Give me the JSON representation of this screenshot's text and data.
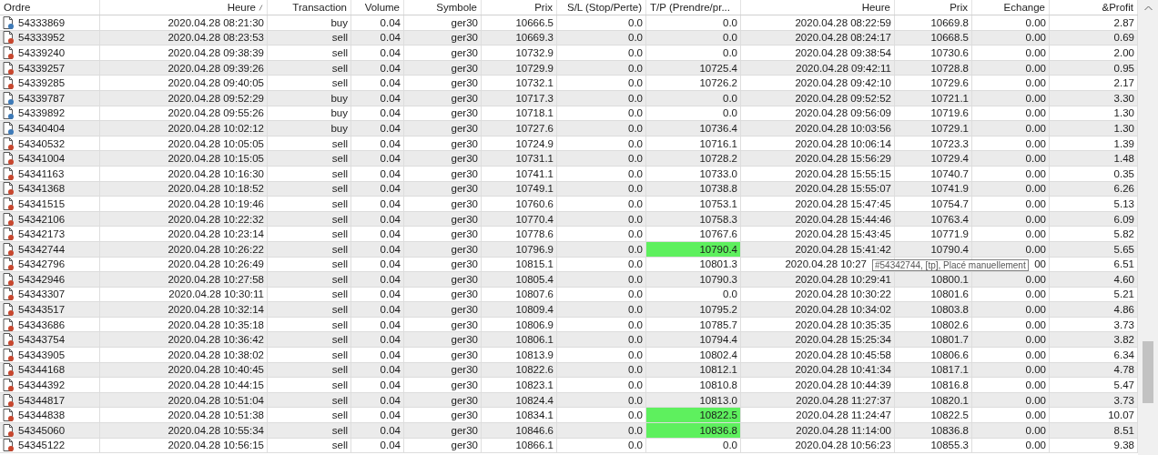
{
  "table": {
    "columns": [
      {
        "label": "Ordre",
        "sorted": false
      },
      {
        "label": "Heure",
        "sorted": true
      },
      {
        "label": "Transaction",
        "sorted": false
      },
      {
        "label": "Volume",
        "sorted": false
      },
      {
        "label": "Symbole",
        "sorted": false
      },
      {
        "label": "Prix",
        "sorted": false
      },
      {
        "label": "S/L (Stop/Perte)",
        "sorted": false
      },
      {
        "label": "T/P (Prendre/pr...",
        "sorted": false
      },
      {
        "label": "Heure",
        "sorted": false
      },
      {
        "label": "Prix",
        "sorted": false
      },
      {
        "label": "Echange",
        "sorted": false
      },
      {
        "label": "&Profit",
        "sorted": false
      }
    ],
    "rows": [
      {
        "kind": "buy",
        "order": "54333869",
        "open_time": "2020.04.28 08:21:30",
        "type": "buy",
        "volume": "0.04",
        "symbol": "ger30",
        "open_price": "10666.5",
        "sl": "0.0",
        "tp": "0.0",
        "tp_highlighted": false,
        "close_time": "2020.04.28 08:22:59",
        "close_price": "10669.8",
        "swap": "0.00",
        "profit": "2.87"
      },
      {
        "kind": "sell",
        "order": "54333952",
        "open_time": "2020.04.28 08:23:53",
        "type": "sell",
        "volume": "0.04",
        "symbol": "ger30",
        "open_price": "10669.3",
        "sl": "0.0",
        "tp": "0.0",
        "tp_highlighted": false,
        "close_time": "2020.04.28 08:24:17",
        "close_price": "10668.5",
        "swap": "0.00",
        "profit": "0.69"
      },
      {
        "kind": "sell",
        "order": "54339240",
        "open_time": "2020.04.28 09:38:39",
        "type": "sell",
        "volume": "0.04",
        "symbol": "ger30",
        "open_price": "10732.9",
        "sl": "0.0",
        "tp": "0.0",
        "tp_highlighted": false,
        "close_time": "2020.04.28 09:38:54",
        "close_price": "10730.6",
        "swap": "0.00",
        "profit": "2.00"
      },
      {
        "kind": "sell",
        "order": "54339257",
        "open_time": "2020.04.28 09:39:26",
        "type": "sell",
        "volume": "0.04",
        "symbol": "ger30",
        "open_price": "10729.9",
        "sl": "0.0",
        "tp": "10725.4",
        "tp_highlighted": false,
        "close_time": "2020.04.28 09:42:11",
        "close_price": "10728.8",
        "swap": "0.00",
        "profit": "0.95"
      },
      {
        "kind": "sell",
        "order": "54339285",
        "open_time": "2020.04.28 09:40:05",
        "type": "sell",
        "volume": "0.04",
        "symbol": "ger30",
        "open_price": "10732.1",
        "sl": "0.0",
        "tp": "10726.2",
        "tp_highlighted": false,
        "close_time": "2020.04.28 09:42:10",
        "close_price": "10729.6",
        "swap": "0.00",
        "profit": "2.17"
      },
      {
        "kind": "buy",
        "order": "54339787",
        "open_time": "2020.04.28 09:52:29",
        "type": "buy",
        "volume": "0.04",
        "symbol": "ger30",
        "open_price": "10717.3",
        "sl": "0.0",
        "tp": "0.0",
        "tp_highlighted": false,
        "close_time": "2020.04.28 09:52:52",
        "close_price": "10721.1",
        "swap": "0.00",
        "profit": "3.30"
      },
      {
        "kind": "buy",
        "order": "54339892",
        "open_time": "2020.04.28 09:55:26",
        "type": "buy",
        "volume": "0.04",
        "symbol": "ger30",
        "open_price": "10718.1",
        "sl": "0.0",
        "tp": "0.0",
        "tp_highlighted": false,
        "close_time": "2020.04.28 09:56:09",
        "close_price": "10719.6",
        "swap": "0.00",
        "profit": "1.30"
      },
      {
        "kind": "buy",
        "order": "54340404",
        "open_time": "2020.04.28 10:02:12",
        "type": "buy",
        "volume": "0.04",
        "symbol": "ger30",
        "open_price": "10727.6",
        "sl": "0.0",
        "tp": "10736.4",
        "tp_highlighted": false,
        "close_time": "2020.04.28 10:03:56",
        "close_price": "10729.1",
        "swap": "0.00",
        "profit": "1.30"
      },
      {
        "kind": "sell",
        "order": "54340532",
        "open_time": "2020.04.28 10:05:05",
        "type": "sell",
        "volume": "0.04",
        "symbol": "ger30",
        "open_price": "10724.9",
        "sl": "0.0",
        "tp": "10716.1",
        "tp_highlighted": false,
        "close_time": "2020.04.28 10:06:14",
        "close_price": "10723.3",
        "swap": "0.00",
        "profit": "1.39"
      },
      {
        "kind": "sell",
        "order": "54341004",
        "open_time": "2020.04.28 10:15:05",
        "type": "sell",
        "volume": "0.04",
        "symbol": "ger30",
        "open_price": "10731.1",
        "sl": "0.0",
        "tp": "10728.2",
        "tp_highlighted": false,
        "close_time": "2020.04.28 15:56:29",
        "close_price": "10729.4",
        "swap": "0.00",
        "profit": "1.48"
      },
      {
        "kind": "sell",
        "order": "54341163",
        "open_time": "2020.04.28 10:16:30",
        "type": "sell",
        "volume": "0.04",
        "symbol": "ger30",
        "open_price": "10741.1",
        "sl": "0.0",
        "tp": "10733.0",
        "tp_highlighted": false,
        "close_time": "2020.04.28 15:55:15",
        "close_price": "10740.7",
        "swap": "0.00",
        "profit": "0.35"
      },
      {
        "kind": "sell",
        "order": "54341368",
        "open_time": "2020.04.28 10:18:52",
        "type": "sell",
        "volume": "0.04",
        "symbol": "ger30",
        "open_price": "10749.1",
        "sl": "0.0",
        "tp": "10738.8",
        "tp_highlighted": false,
        "close_time": "2020.04.28 15:55:07",
        "close_price": "10741.9",
        "swap": "0.00",
        "profit": "6.26"
      },
      {
        "kind": "sell",
        "order": "54341515",
        "open_time": "2020.04.28 10:19:46",
        "type": "sell",
        "volume": "0.04",
        "symbol": "ger30",
        "open_price": "10760.6",
        "sl": "0.0",
        "tp": "10753.1",
        "tp_highlighted": false,
        "close_time": "2020.04.28 15:47:45",
        "close_price": "10754.7",
        "swap": "0.00",
        "profit": "5.13"
      },
      {
        "kind": "sell",
        "order": "54342106",
        "open_time": "2020.04.28 10:22:32",
        "type": "sell",
        "volume": "0.04",
        "symbol": "ger30",
        "open_price": "10770.4",
        "sl": "0.0",
        "tp": "10758.3",
        "tp_highlighted": false,
        "close_time": "2020.04.28 15:44:46",
        "close_price": "10763.4",
        "swap": "0.00",
        "profit": "6.09"
      },
      {
        "kind": "sell",
        "order": "54342173",
        "open_time": "2020.04.28 10:23:14",
        "type": "sell",
        "volume": "0.04",
        "symbol": "ger30",
        "open_price": "10778.6",
        "sl": "0.0",
        "tp": "10767.6",
        "tp_highlighted": false,
        "close_time": "2020.04.28 15:43:45",
        "close_price": "10771.9",
        "swap": "0.00",
        "profit": "5.82"
      },
      {
        "kind": "sell",
        "order": "54342744",
        "open_time": "2020.04.28 10:26:22",
        "type": "sell",
        "volume": "0.04",
        "symbol": "ger30",
        "open_price": "10796.9",
        "sl": "0.0",
        "tp": "10790.4",
        "tp_highlighted": true,
        "close_time": "2020.04.28 15:41:42",
        "close_price": "10790.4",
        "swap": "0.00",
        "profit": "5.65"
      },
      {
        "kind": "sell",
        "order": "54342796",
        "open_time": "2020.04.28 10:26:49",
        "type": "sell",
        "volume": "0.04",
        "symbol": "ger30",
        "open_price": "10815.1",
        "sl": "0.0",
        "tp": "10801.3",
        "tp_highlighted": false,
        "close_time": "2020.04.28 10:27",
        "swap": "00",
        "profit": "6.51",
        "tooltip": "#54342744, [tp], Placé manuellement"
      },
      {
        "kind": "sell",
        "order": "54342946",
        "open_time": "2020.04.28 10:27:58",
        "type": "sell",
        "volume": "0.04",
        "symbol": "ger30",
        "open_price": "10805.4",
        "sl": "0.0",
        "tp": "10790.3",
        "tp_highlighted": false,
        "close_time": "2020.04.28 10:29:41",
        "close_price": "10800.1",
        "swap": "0.00",
        "profit": "4.60"
      },
      {
        "kind": "sell",
        "order": "54343307",
        "open_time": "2020.04.28 10:30:11",
        "type": "sell",
        "volume": "0.04",
        "symbol": "ger30",
        "open_price": "10807.6",
        "sl": "0.0",
        "tp": "0.0",
        "tp_highlighted": false,
        "close_time": "2020.04.28 10:30:22",
        "close_price": "10801.6",
        "swap": "0.00",
        "profit": "5.21"
      },
      {
        "kind": "sell",
        "order": "54343517",
        "open_time": "2020.04.28 10:32:14",
        "type": "sell",
        "volume": "0.04",
        "symbol": "ger30",
        "open_price": "10809.4",
        "sl": "0.0",
        "tp": "10795.2",
        "tp_highlighted": false,
        "close_time": "2020.04.28 10:34:02",
        "close_price": "10803.8",
        "swap": "0.00",
        "profit": "4.86"
      },
      {
        "kind": "sell",
        "order": "54343686",
        "open_time": "2020.04.28 10:35:18",
        "type": "sell",
        "volume": "0.04",
        "symbol": "ger30",
        "open_price": "10806.9",
        "sl": "0.0",
        "tp": "10785.7",
        "tp_highlighted": false,
        "close_time": "2020.04.28 10:35:35",
        "close_price": "10802.6",
        "swap": "0.00",
        "profit": "3.73"
      },
      {
        "kind": "sell",
        "order": "54343754",
        "open_time": "2020.04.28 10:36:42",
        "type": "sell",
        "volume": "0.04",
        "symbol": "ger30",
        "open_price": "10806.1",
        "sl": "0.0",
        "tp": "10794.4",
        "tp_highlighted": false,
        "close_time": "2020.04.28 15:25:34",
        "close_price": "10801.7",
        "swap": "0.00",
        "profit": "3.82"
      },
      {
        "kind": "sell",
        "order": "54343905",
        "open_time": "2020.04.28 10:38:02",
        "type": "sell",
        "volume": "0.04",
        "symbol": "ger30",
        "open_price": "10813.9",
        "sl": "0.0",
        "tp": "10802.4",
        "tp_highlighted": false,
        "close_time": "2020.04.28 10:45:58",
        "close_price": "10806.6",
        "swap": "0.00",
        "profit": "6.34"
      },
      {
        "kind": "sell",
        "order": "54344168",
        "open_time": "2020.04.28 10:40:45",
        "type": "sell",
        "volume": "0.04",
        "symbol": "ger30",
        "open_price": "10822.6",
        "sl": "0.0",
        "tp": "10812.1",
        "tp_highlighted": false,
        "close_time": "2020.04.28 10:41:34",
        "close_price": "10817.1",
        "swap": "0.00",
        "profit": "4.78"
      },
      {
        "kind": "sell",
        "order": "54344392",
        "open_time": "2020.04.28 10:44:15",
        "type": "sell",
        "volume": "0.04",
        "symbol": "ger30",
        "open_price": "10823.1",
        "sl": "0.0",
        "tp": "10810.8",
        "tp_highlighted": false,
        "close_time": "2020.04.28 10:44:39",
        "close_price": "10816.8",
        "swap": "0.00",
        "profit": "5.47"
      },
      {
        "kind": "sell",
        "order": "54344817",
        "open_time": "2020.04.28 10:51:04",
        "type": "sell",
        "volume": "0.04",
        "symbol": "ger30",
        "open_price": "10824.4",
        "sl": "0.0",
        "tp": "10813.0",
        "tp_highlighted": false,
        "close_time": "2020.04.28 11:27:37",
        "close_price": "10820.1",
        "swap": "0.00",
        "profit": "3.73"
      },
      {
        "kind": "sell",
        "order": "54344838",
        "open_time": "2020.04.28 10:51:38",
        "type": "sell",
        "volume": "0.04",
        "symbol": "ger30",
        "open_price": "10834.1",
        "sl": "0.0",
        "tp": "10822.5",
        "tp_highlighted": true,
        "close_time": "2020.04.28 11:24:47",
        "close_price": "10822.5",
        "swap": "0.00",
        "profit": "10.07"
      },
      {
        "kind": "sell",
        "order": "54345060",
        "open_time": "2020.04.28 10:55:34",
        "type": "sell",
        "volume": "0.04",
        "symbol": "ger30",
        "open_price": "10846.6",
        "sl": "0.0",
        "tp": "10836.8",
        "tp_highlighted": true,
        "close_time": "2020.04.28 11:14:00",
        "close_price": "10836.8",
        "swap": "0.00",
        "profit": "8.51"
      },
      {
        "kind": "sell",
        "order": "54345122",
        "open_time": "2020.04.28 10:56:15",
        "type": "sell",
        "volume": "0.04",
        "symbol": "ger30",
        "open_price": "10866.1",
        "sl": "0.0",
        "tp": "0.0",
        "tp_highlighted": false,
        "close_time": "2020.04.28 10:56:23",
        "close_price": "10855.3",
        "swap": "0.00",
        "profit": "9.38"
      }
    ]
  }
}
